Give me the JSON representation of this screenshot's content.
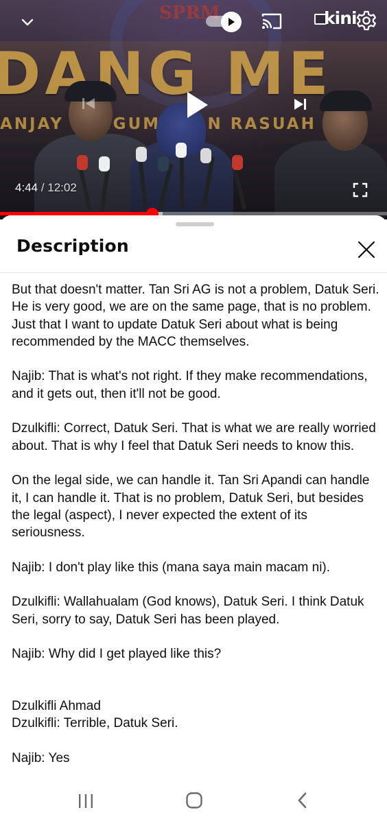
{
  "video": {
    "banner_text": "DANG ME",
    "banner_subtext": "ANJAY PENGUMUMAN RASUAH",
    "sprm_text": "SPRM",
    "channel_logo": "kini",
    "time_current": "4:44",
    "time_separator": " / ",
    "time_duration": "12:02",
    "progress_fraction": 0.394,
    "buffer_fraction": 0.42,
    "accent_color": "#ff0000",
    "icons": {
      "collapse": "chevron-down-icon",
      "autoplay": "autoplay-toggle-icon",
      "cast": "cast-icon",
      "settings": "gear-icon",
      "previous": "skip-previous-icon",
      "play": "play-icon",
      "next": "skip-next-icon",
      "fullscreen": "fullscreen-icon"
    }
  },
  "sheet": {
    "title": "Description",
    "close_icon": "close-icon",
    "paragraphs": [
      "But that doesn't matter. Tan Sri AG is not a problem, Datuk Seri. He is very good, we are on the same page, that is no problem. Just that I want to update Datuk Seri about what is being recommended by the MACC themselves.",
      "Najib: That is what's not right. If they make recommendations, and it gets out, then it'll not be good.",
      "Dzulkifli: Correct, Datuk Seri. That is what we are really worried about. That is why I feel that Datuk Seri needs to know this.",
      "On the legal side, we can handle it. Tan Sri Apandi can handle it, I can handle it. That is no problem, Datuk Seri, but besides the legal (aspect), I never expected the extent of its seriousness.",
      "Najib: I don't play like this (mana saya main macam ni).",
      "Dzulkifli: Wallahualam (God knows), Datuk Seri. I think Datuk Seri, sorry to say, Datuk Seri has been played.",
      "Najib: Why did I get played like this?"
    ],
    "speaker_heading": "Dzulkifli Ahmad",
    "after_heading": [
      "Dzulkifli: Terrible, Datuk Seri.",
      "Najib: Yes"
    ]
  },
  "nav": {
    "recents_icon": "recents-icon",
    "home_icon": "home-icon",
    "back_icon": "back-icon"
  }
}
